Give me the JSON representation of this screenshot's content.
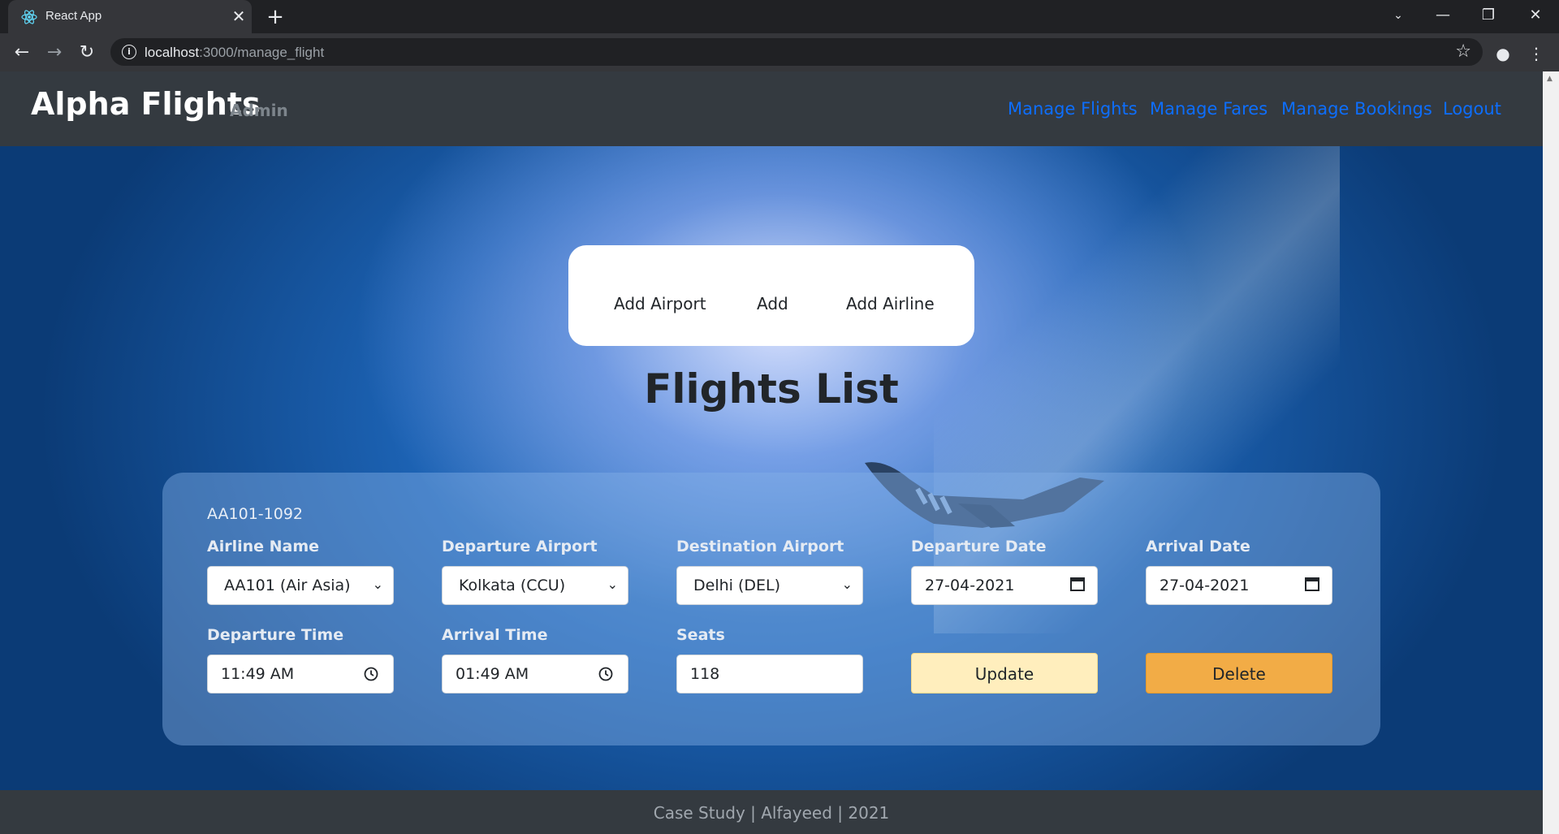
{
  "browser": {
    "tab_title": "React App",
    "url_host": "localhost",
    "url_path": ":3000/manage_flight"
  },
  "header": {
    "brand": "Alpha Flights",
    "brand_sub": "Admin",
    "nav": [
      "Manage Flights",
      "Manage Fares",
      "Manage Bookings",
      "Logout"
    ]
  },
  "actions": [
    "Add Airport",
    "Add",
    "Add Airline"
  ],
  "page_title": "Flights List",
  "flight": {
    "code": "AA101-1092",
    "labels": {
      "airline": "Airline Name",
      "departure_airport": "Departure Airport",
      "destination_airport": "Destination Airport",
      "departure_date": "Departure Date",
      "arrival_date": "Arrival Date",
      "departure_time": "Departure Time",
      "arrival_time": "Arrival Time",
      "seats": "Seats"
    },
    "values": {
      "airline": "AA101 (Air Asia)",
      "departure_airport": "Kolkata (CCU)",
      "destination_airport": "Delhi (DEL)",
      "departure_date": "27-04-2021",
      "arrival_date": "27-04-2021",
      "departure_time": "11:49 AM",
      "arrival_time": "01:49 AM",
      "seats": "118"
    },
    "update_label": "Update",
    "delete_label": "Delete"
  },
  "footer": "Case Study | Alfayeed | 2021",
  "colors": {
    "nav_link": "#0d6efd",
    "header_bg": "#343a40",
    "update_btn": "#ffeebd",
    "delete_btn": "#f2ac46"
  }
}
